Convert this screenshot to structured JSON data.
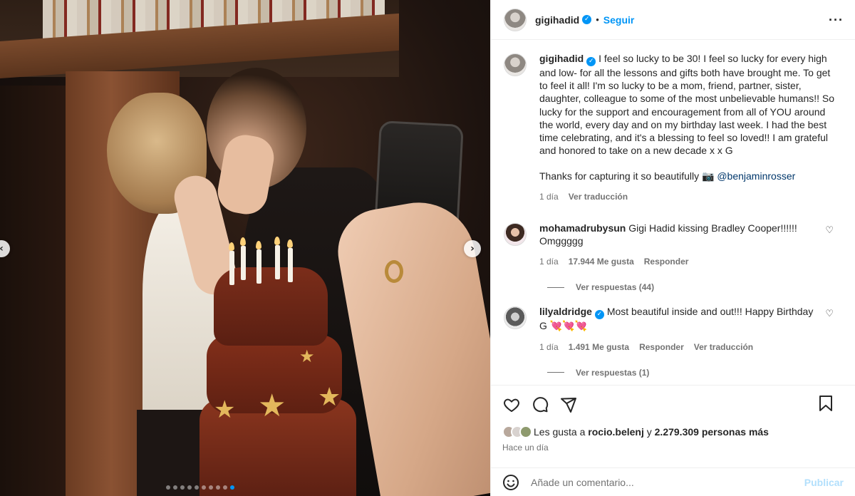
{
  "post": {
    "author": {
      "username": "gigihadid",
      "verified": true,
      "follow_label": "Seguir",
      "separator": "•"
    },
    "media": {
      "slide_count": 10,
      "active_slide": 10,
      "prev_arrow": "‹",
      "next_arrow": "›"
    },
    "caption": {
      "lines": [
        "I feel so lucky to be 30! I feel so lucky for every high",
        "and low- for all the lessons and gifts both have brought me. To get",
        "to feel it all! I'm so lucky to be a mom, friend, partner, sister,",
        "daughter, colleague to some of the most unbelievable humans!! So",
        "lucky for the support and encouragement from all of YOU around",
        "the world, every day and on my birthday last week. I had the best",
        "time celebrating, and it's a blessing to feel so loved!! I am grateful",
        "and honored to take on a new decade x x G"
      ],
      "thanks_text": "Thanks for capturing it so beautifully",
      "thanks_emoji": "📷",
      "mention": "@benjaminrosser",
      "time": "1 día",
      "translate_label": "Ver traducción"
    },
    "comments": [
      {
        "username": "mohamadrubysun",
        "verified": false,
        "text_line1": "Gigi Hadid kissing Bradley Cooper!!!!!!",
        "text_line2": "Omggggg",
        "time": "1 día",
        "likes": "17.944 Me gusta",
        "reply_label": "Responder",
        "view_replies": "Ver respuestas (44)"
      },
      {
        "username": "lilyaldridge",
        "verified": true,
        "text_line1": "Most beautiful inside and out!!! Happy Birthday",
        "text_line2": "G 💘💘💘",
        "time": "1 día",
        "likes": "1.491 Me gusta",
        "reply_label": "Responder",
        "translate_label": "Ver traducción",
        "view_replies": "Ver respuestas (1)"
      }
    ],
    "actions": {
      "icons": [
        "heart-icon",
        "comment-icon",
        "share-icon",
        "bookmark-icon"
      ],
      "likes_prefix": "Les gusta a",
      "likes_user": "rocio.belenj",
      "likes_connector": "y",
      "likes_count": "2.279.309 personas más",
      "posted_time": "Hace un día"
    },
    "composer": {
      "placeholder": "Añade un comentario...",
      "publish_label": "Publicar"
    },
    "colors": {
      "accent": "#0095f6",
      "muted": "#737373",
      "publish_disabled": "#b2dffc"
    }
  }
}
